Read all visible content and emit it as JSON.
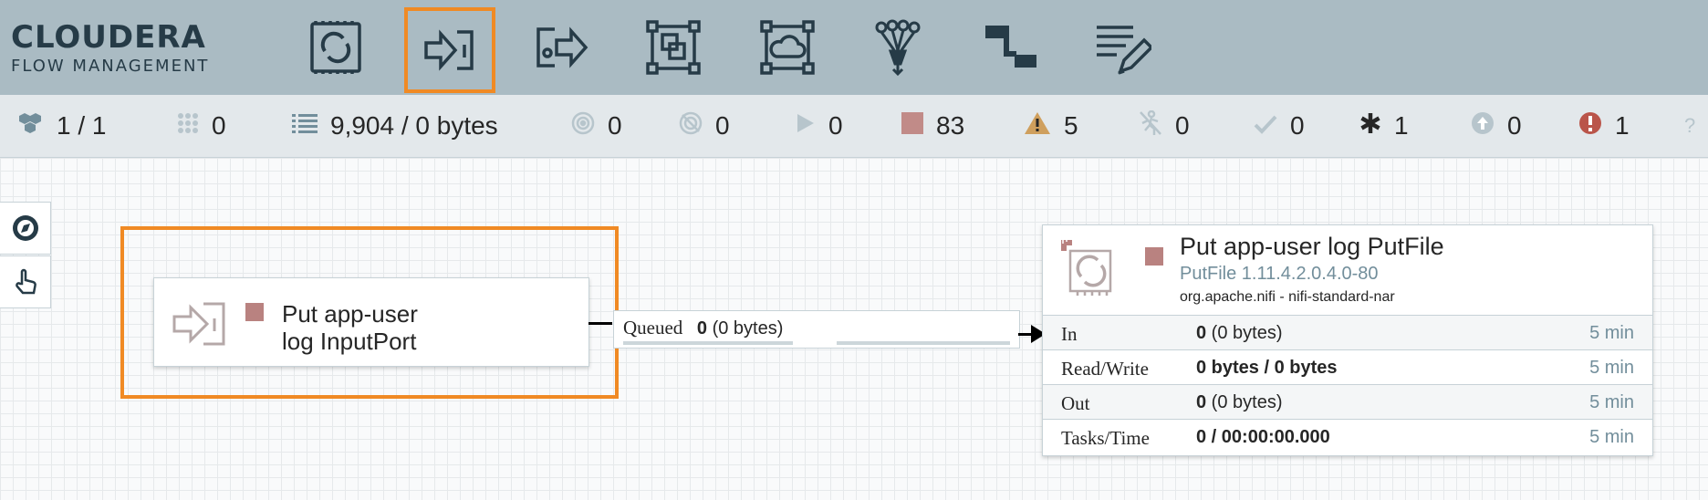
{
  "brand": {
    "name": "CLOUDERA",
    "subtitle": "FLOW MANAGEMENT"
  },
  "toolbar": {
    "tools": [
      {
        "name": "processor",
        "icon": "processor-icon",
        "selected": false
      },
      {
        "name": "input-port",
        "icon": "input-port-icon",
        "selected": true
      },
      {
        "name": "output-port",
        "icon": "output-port-icon",
        "selected": false
      },
      {
        "name": "process-group",
        "icon": "process-group-icon",
        "selected": false
      },
      {
        "name": "remote-process-group",
        "icon": "remote-process-group-icon",
        "selected": false
      },
      {
        "name": "funnel",
        "icon": "funnel-icon",
        "selected": false
      },
      {
        "name": "template",
        "icon": "template-icon",
        "selected": false
      },
      {
        "name": "label",
        "icon": "label-icon",
        "selected": false
      }
    ],
    "accent": "#f08a24"
  },
  "status": {
    "cluster": "1 / 1",
    "threads": "0",
    "queued": "9,904 / 0 bytes",
    "transmitting": "0",
    "not_transmitting": "0",
    "running": "0",
    "stopped": "83",
    "invalid": "5",
    "disabled": "0",
    "up_to_date": "0",
    "locally_modified": "1",
    "stale": "0",
    "sync_failure": "1",
    "help": "?"
  },
  "canvas": {
    "input_port": {
      "name": "Put app-user\nlog InputPort",
      "state_color": "#b98280"
    },
    "connection": {
      "label": "Queued",
      "count": "0",
      "size": "(0 bytes)"
    },
    "processor": {
      "name": "Put app-user log PutFile",
      "type": "PutFile 1.11.4.2.0.4.0-80",
      "bundle": "org.apache.nifi - nifi-standard-nar",
      "state_color": "#b98280",
      "stats": [
        {
          "label": "In",
          "value_bold": "0",
          "value_rest": " (0 bytes)",
          "time": "5 min"
        },
        {
          "label": "Read/Write",
          "value_bold": "0 bytes / 0 bytes",
          "value_rest": "",
          "time": "5 min"
        },
        {
          "label": "Out",
          "value_bold": "0",
          "value_rest": " (0 bytes)",
          "time": "5 min"
        },
        {
          "label": "Tasks/Time",
          "value_bold": "0 / 00:00:00.000",
          "value_rest": "",
          "time": "5 min"
        }
      ]
    }
  }
}
